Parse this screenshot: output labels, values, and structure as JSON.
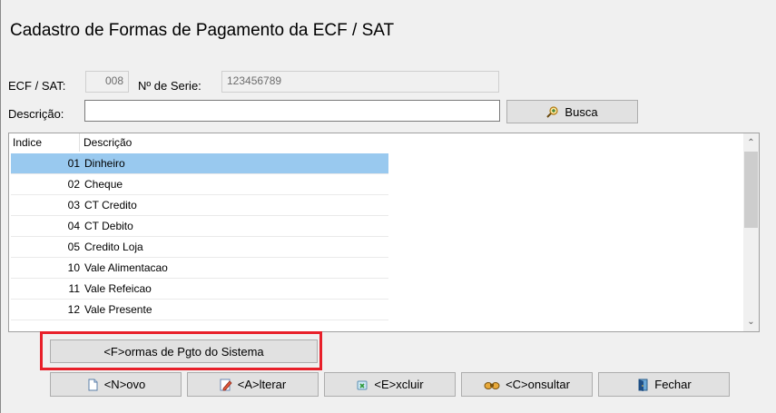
{
  "window": {
    "title": "Cadastro de Formas de Pagamento da ECF / SAT"
  },
  "fields": {
    "ecf_label": "ECF / SAT:",
    "ecf_value": "008",
    "serie_label": "Nº de Serie:",
    "serie_value": "123456789",
    "descricao_label": "Descrição:",
    "descricao_value": ""
  },
  "buttons": {
    "busca": "Busca",
    "formas_sistema": "<F>ormas de Pgto do Sistema",
    "novo": "<N>ovo",
    "alterar": "<A>lterar",
    "excluir": "<E>xcluir",
    "consultar": "<C>onsultar",
    "fechar": "Fechar"
  },
  "grid": {
    "columns": [
      "Indice",
      "Descrição"
    ],
    "rows": [
      {
        "indice": "01",
        "descricao": "Dinheiro",
        "selected": true
      },
      {
        "indice": "02",
        "descricao": "Cheque"
      },
      {
        "indice": "03",
        "descricao": "CT Credito"
      },
      {
        "indice": "04",
        "descricao": "CT Debito"
      },
      {
        "indice": "05",
        "descricao": "Credito Loja"
      },
      {
        "indice": "10",
        "descricao": "Vale Alimentacao"
      },
      {
        "indice": "11",
        "descricao": "Vale Refeicao"
      },
      {
        "indice": "12",
        "descricao": "Vale Presente"
      }
    ]
  },
  "colors": {
    "selection": "#99c9ef",
    "highlight_border": "#e8202a"
  },
  "icons": {
    "busca": "magnifier-plus-icon",
    "novo": "new-document-icon",
    "alterar": "pencil-icon",
    "excluir": "delete-icon",
    "consultar": "binoculars-icon",
    "fechar": "door-exit-icon"
  }
}
